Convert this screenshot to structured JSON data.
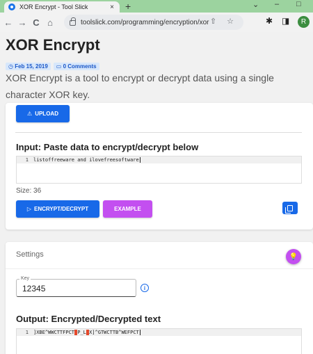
{
  "browser": {
    "tab_title": "XOR Encrypt - Tool Slick",
    "tab_close": "×",
    "new_tab": "+",
    "url": "toolslick.com/programming/encryption/xor",
    "nav": {
      "back": "←",
      "forward": "→",
      "reload": "C",
      "home": "⌂"
    },
    "omni_icons": "⇧ ☆",
    "extensions": {
      "puzzle": "✱",
      "sidebar": "◨"
    },
    "profile_initial": "R",
    "window": {
      "chevron": "⌄",
      "minimize": "–",
      "maximize": "□"
    }
  },
  "page": {
    "title": "XOR Encrypt",
    "date": "Feb 15, 2019",
    "comments": "0 Comments",
    "description": "XOR Encrypt is a tool to encrypt or decrypt data using a single character XOR key."
  },
  "upload": {
    "label": "UPLOAD"
  },
  "input": {
    "heading": "Input: Paste data to encrypt/decrypt below",
    "line_number": "1",
    "text": "listoffreeware and ilovefreesoftware",
    "size_label": "Size: 36"
  },
  "actions": {
    "encrypt_label": "ENCRYPT/DECRYPT",
    "example_label": "EXAMPLE"
  },
  "settings": {
    "label": "Settings",
    "key_label": "Key",
    "key_value": "12345",
    "info_glyph": "i",
    "bulb_glyph": "💡"
  },
  "output": {
    "heading": "Output: Encrypted/Decrypted text",
    "line_number": "1",
    "segments": [
      "]XBE^WWCTTFPCT",
      " ",
      "P_L",
      " ",
      "X]^GTWCTTB^WEFPCT"
    ]
  },
  "colors": {
    "primary": "#1869e8",
    "purple": "#c34ff0",
    "browser_frame": "#9cd39f"
  }
}
